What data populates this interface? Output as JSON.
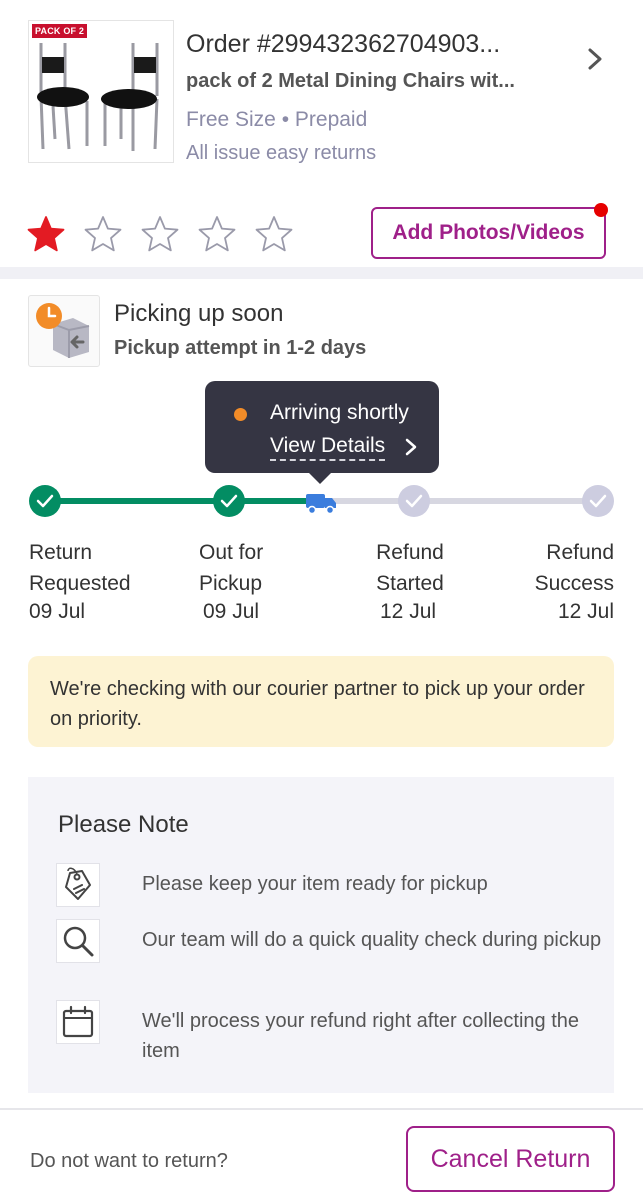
{
  "product": {
    "order_title": "Order #299432362704903...",
    "name": "pack of 2 Metal Dining Chairs wit...",
    "meta": "Free Size • Prepaid",
    "returns_note": "All issue easy returns",
    "image_badge": "PACK OF 2"
  },
  "rating": {
    "value": 1,
    "max": 5,
    "filled_color": "#e31b23"
  },
  "add_photos_label": "Add Photos/Videos",
  "status": {
    "title": "Picking up soon",
    "subtitle": "Pickup attempt in 1-2 days"
  },
  "tooltip": {
    "text": "Arriving shortly",
    "link": "View Details"
  },
  "tracker": {
    "progress_between_steps": 1.5,
    "steps": [
      {
        "line1": "Return",
        "line2": "Requested",
        "date": "09 Jul",
        "done": true
      },
      {
        "line1": "Out for",
        "line2": "Pickup",
        "date": "09 Jul",
        "done": true
      },
      {
        "line1": "Refund",
        "line2": "Started",
        "date": "12 Jul",
        "done": false
      },
      {
        "line1": "Refund",
        "line2": "Success",
        "date": "12 Jul",
        "done": false
      }
    ]
  },
  "courier_banner": "We're checking with our courier partner to pick up your order on priority.",
  "note": {
    "title": "Please Note",
    "items": [
      {
        "icon": "tag-icon",
        "text": "Please keep your item ready for pickup"
      },
      {
        "icon": "search-icon",
        "text": "Our team will do a quick quality check during pickup"
      },
      {
        "icon": "calendar-icon",
        "text": "We'll process your refund right after collecting the item"
      }
    ]
  },
  "bottom": {
    "prompt": "Do not want to return?",
    "cancel_label": "Cancel Return"
  },
  "colors": {
    "brand": "#9f2089",
    "success": "#038d63",
    "pending": "#cdcde0",
    "truck": "#3b7ddd",
    "banner_bg": "#fdf3d3"
  }
}
